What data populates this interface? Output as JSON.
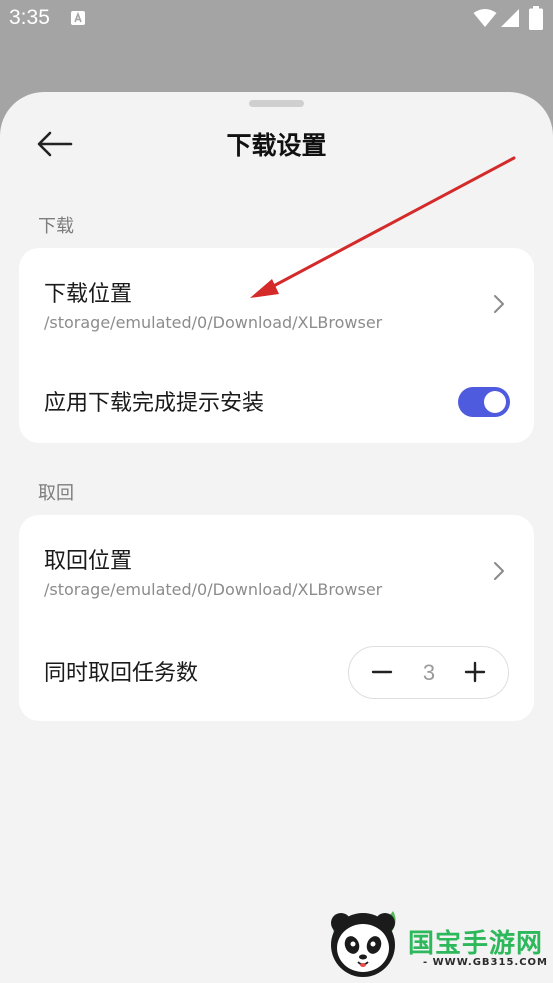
{
  "status_bar": {
    "time": "3:35",
    "notification_icon": "a-icon",
    "icons": [
      "wifi-icon",
      "signal-icon",
      "battery-icon"
    ]
  },
  "header": {
    "back_icon": "back-arrow-icon",
    "title": "下载设置"
  },
  "download_section": {
    "label": "下载",
    "location": {
      "title": "下载位置",
      "path": "/storage/emulated/0/Download/XLBrowser"
    },
    "install_prompt": {
      "title": "应用下载完成提示安装",
      "enabled": true
    }
  },
  "retrieve_section": {
    "label": "取回",
    "location": {
      "title": "取回位置",
      "path": "/storage/emulated/0/Download/XLBrowser"
    },
    "concurrent_tasks": {
      "title": "同时取回任务数",
      "value": "3",
      "minus_icon": "minus-icon",
      "plus_icon": "plus-icon"
    }
  },
  "watermark": {
    "brand": "国宝手游网",
    "url": "- WWW.GB315.COM -"
  },
  "colors": {
    "accent": "#4f5bdf",
    "annotation_arrow": "#d42a2a",
    "sheet_background": "#f3f3f3",
    "dim_background": "#a4a4a4",
    "watermark_green": "#2eb85c"
  }
}
